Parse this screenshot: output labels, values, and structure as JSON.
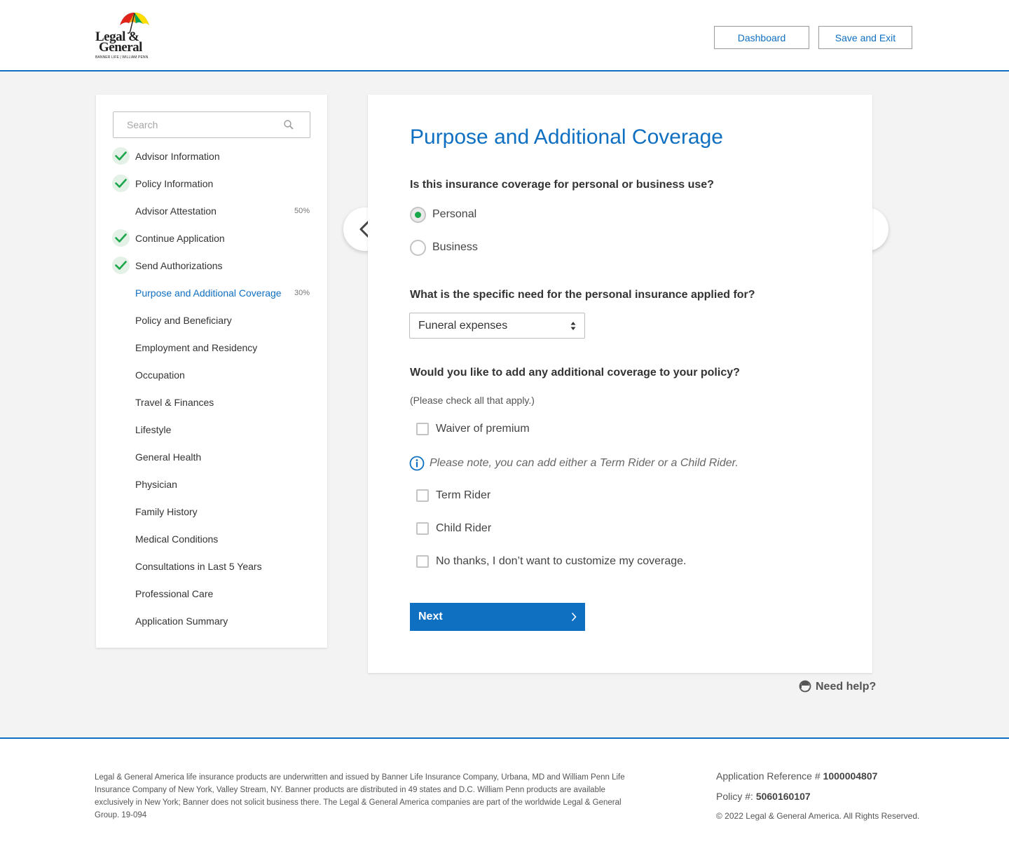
{
  "brand": {
    "line1": "Legal &",
    "line2": "General",
    "tagline": "BANNER LIFE | WILLIAM PENN",
    "umbrella_colors": [
      "#e2231a",
      "#f7a600",
      "#0f6fc1",
      "#00a651",
      "#ffde00"
    ]
  },
  "header": {
    "dashboard_label": "Dashboard",
    "save_exit_label": "Save and Exit"
  },
  "sidebar": {
    "search_placeholder": "Search",
    "items": [
      {
        "label": "Advisor Information",
        "complete": true,
        "percent": ""
      },
      {
        "label": "Policy Information",
        "complete": true,
        "percent": ""
      },
      {
        "label": "Advisor Attestation",
        "complete": false,
        "percent": "50%"
      },
      {
        "label": "Continue Application",
        "complete": true,
        "percent": ""
      },
      {
        "label": "Send Authorizations",
        "complete": true,
        "percent": ""
      },
      {
        "label": "Purpose and Additional Coverage",
        "complete": false,
        "percent": "30%",
        "active": true
      },
      {
        "label": "Policy and Beneficiary",
        "complete": false,
        "percent": ""
      },
      {
        "label": "Employment and Residency",
        "complete": false,
        "percent": ""
      },
      {
        "label": "Occupation",
        "complete": false,
        "percent": ""
      },
      {
        "label": "Travel & Finances",
        "complete": false,
        "percent": ""
      },
      {
        "label": "Lifestyle",
        "complete": false,
        "percent": ""
      },
      {
        "label": "General Health",
        "complete": false,
        "percent": ""
      },
      {
        "label": "Physician",
        "complete": false,
        "percent": ""
      },
      {
        "label": "Family History",
        "complete": false,
        "percent": ""
      },
      {
        "label": "Medical Conditions",
        "complete": false,
        "percent": ""
      },
      {
        "label": "Consultations in Last 5 Years",
        "complete": false,
        "percent": ""
      },
      {
        "label": "Professional Care",
        "complete": false,
        "percent": ""
      },
      {
        "label": "Application Summary",
        "complete": false,
        "percent": ""
      }
    ]
  },
  "main": {
    "title": "Purpose and Additional Coverage",
    "q1": {
      "text": "Is this insurance coverage for personal or business use?",
      "options": [
        "Personal",
        "Business"
      ],
      "selected": "Personal"
    },
    "q2": {
      "text": "What is the specific need for the personal insurance applied for?",
      "selected_value": "Funeral expenses"
    },
    "q3": {
      "text": "Would you like to add any additional coverage to your policy?",
      "hint": "(Please check all that apply.)",
      "options": [
        "Waiver of premium",
        "Term Rider",
        "Child Rider",
        "No thanks, I don’t want to customize my coverage."
      ],
      "note": "Please note, you can add either a Term Rider or a Child Rider."
    },
    "next_label": "Next",
    "help_label": "Need help?"
  },
  "footer": {
    "disclaimer": "Legal & General America life insurance products are underwritten and issued by Banner Life Insurance Company, Urbana, MD and William Penn Life Insurance Company of New York, Valley Stream, NY. Banner products are distributed in 49 states and D.C. William Penn products are available exclusively in New York; Banner does not solicit business there. The Legal & General America companies are part of the worldwide Legal & General Group. 19-094",
    "app_ref_label": "Application Reference #",
    "app_ref_value": "1000004807",
    "policy_label": "Policy #:",
    "policy_value": "5060160107",
    "copyright": "© 2022 Legal & General America. All Rights Reserved."
  },
  "colors": {
    "accent": "#0f6fc1",
    "success": "#1aa64a",
    "check_bg": "#e3f1e7"
  }
}
